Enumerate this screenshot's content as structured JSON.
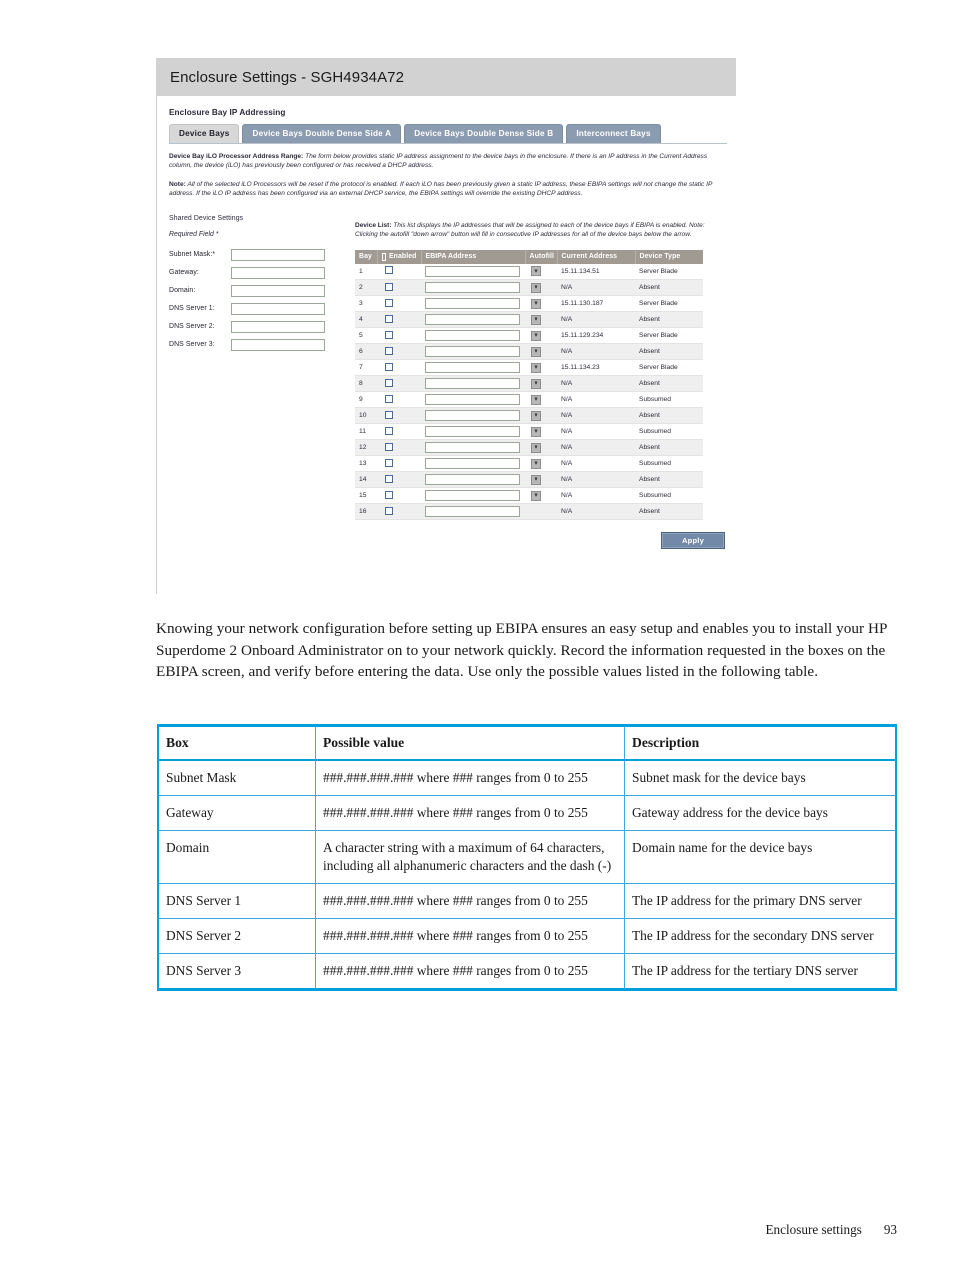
{
  "screenshot": {
    "title": "Enclosure Settings - SGH4934A72",
    "section_label": "Enclosure Bay IP Addressing",
    "tabs": [
      {
        "label": "Device Bays",
        "active": true
      },
      {
        "label": "Device Bays Double Dense Side A",
        "active": false
      },
      {
        "label": "Device Bays Double Dense Side B",
        "active": false
      },
      {
        "label": "Interconnect Bays",
        "active": false
      }
    ],
    "notes": [
      {
        "lead": "Device Bay iLO Processor Address Range:",
        "text": " The form below provides static IP address assignment to the device bays in the enclosure. If there is an IP address in the Current Address column, the device (iLO) has previously been configured or has received a DHCP address."
      },
      {
        "lead": "Note:",
        "text": " All of the selected iLO Processors will be reset if the protocol is enabled. If each iLO has been previously given a static IP address, these EBIPA settings will not change the static IP address. If the iLO IP address has been configured via an external DHCP service, the EBIPA settings will override the existing DHCP address."
      }
    ],
    "shared_settings": {
      "heading": "Shared Device Settings",
      "required_note": "Required Field *",
      "fields": [
        {
          "label": "Subnet Mask:*",
          "value": ""
        },
        {
          "label": "Gateway:",
          "value": ""
        },
        {
          "label": "Domain:",
          "value": ""
        },
        {
          "label": "DNS Server 1:",
          "value": ""
        },
        {
          "label": "DNS Server 2:",
          "value": ""
        },
        {
          "label": "DNS Server 3:",
          "value": ""
        }
      ]
    },
    "device_list": {
      "note_lead": "Device List:",
      "note_text": " This list displays the IP addresses that will be assigned to each of the device bays if EBIPA is enabled.  Note:  Clicking the autofill \"down arrow\" button will fill in consecutive IP addresses for all of the device bays below the arrow.",
      "columns": [
        "Bay",
        "Enabled",
        "EBIPA Address",
        "Autofill",
        "Current Address",
        "Device Type"
      ],
      "rows": [
        {
          "bay": "1",
          "enabled": false,
          "ebipa": "",
          "autofill": true,
          "current": "15.11.134.51",
          "type": "Server Blade"
        },
        {
          "bay": "2",
          "enabled": false,
          "ebipa": "",
          "autofill": true,
          "current": "N/A",
          "type": "Absent"
        },
        {
          "bay": "3",
          "enabled": false,
          "ebipa": "",
          "autofill": true,
          "current": "15.11.130.187",
          "type": "Server Blade"
        },
        {
          "bay": "4",
          "enabled": false,
          "ebipa": "",
          "autofill": true,
          "current": "N/A",
          "type": "Absent"
        },
        {
          "bay": "5",
          "enabled": false,
          "ebipa": "",
          "autofill": true,
          "current": "15.11.129.234",
          "type": "Server Blade"
        },
        {
          "bay": "6",
          "enabled": false,
          "ebipa": "",
          "autofill": true,
          "current": "N/A",
          "type": "Absent"
        },
        {
          "bay": "7",
          "enabled": false,
          "ebipa": "",
          "autofill": true,
          "current": "15.11.134.23",
          "type": "Server Blade"
        },
        {
          "bay": "8",
          "enabled": false,
          "ebipa": "",
          "autofill": true,
          "current": "N/A",
          "type": "Absent"
        },
        {
          "bay": "9",
          "enabled": false,
          "ebipa": "",
          "autofill": true,
          "current": "N/A",
          "type": "Subsumed"
        },
        {
          "bay": "10",
          "enabled": false,
          "ebipa": "",
          "autofill": true,
          "current": "N/A",
          "type": "Absent"
        },
        {
          "bay": "11",
          "enabled": false,
          "ebipa": "",
          "autofill": true,
          "current": "N/A",
          "type": "Subsumed"
        },
        {
          "bay": "12",
          "enabled": false,
          "ebipa": "",
          "autofill": true,
          "current": "N/A",
          "type": "Absent"
        },
        {
          "bay": "13",
          "enabled": false,
          "ebipa": "",
          "autofill": true,
          "current": "N/A",
          "type": "Subsumed"
        },
        {
          "bay": "14",
          "enabled": false,
          "ebipa": "",
          "autofill": true,
          "current": "N/A",
          "type": "Absent"
        },
        {
          "bay": "15",
          "enabled": false,
          "ebipa": "",
          "autofill": true,
          "current": "N/A",
          "type": "Subsumed"
        },
        {
          "bay": "16",
          "enabled": false,
          "ebipa": "",
          "autofill": false,
          "current": "N/A",
          "type": "Absent"
        }
      ]
    },
    "apply_label": "Apply",
    "autofill_glyph": "▾"
  },
  "body_paragraph": "Knowing your network configuration before setting up EBIPA ensures an easy setup and enables you to install your HP Superdome 2 Onboard Administrator on to your network quickly. Record the information requested in the boxes on the EBIPA screen, and verify before entering the data. Use only the possible values listed in the following table.",
  "data_table": {
    "headers": [
      "Box",
      "Possible value",
      "Description"
    ],
    "rows": [
      {
        "box": "Subnet Mask",
        "value": "###.###.###.### where ### ranges from 0 to 255",
        "description": "Subnet mask for the device bays"
      },
      {
        "box": "Gateway",
        "value": "###.###.###.### where ### ranges from 0 to 255",
        "description": "Gateway address for the device bays"
      },
      {
        "box": "Domain",
        "value": "A character string with a maximum of 64 characters, including all alphanumeric characters and the dash (-)",
        "description": "Domain name for the device bays"
      },
      {
        "box": "DNS Server 1",
        "value": "###.###.###.### where ### ranges from 0 to 255",
        "description": "The IP address for the primary DNS server"
      },
      {
        "box": "DNS Server 2",
        "value": "###.###.###.### where ### ranges from 0 to 255",
        "description": "The IP address for the secondary DNS server"
      },
      {
        "box": "DNS Server 3",
        "value": "###.###.###.### where ### ranges from 0 to 255",
        "description": "The IP address for the tertiary DNS server"
      }
    ]
  },
  "footer": {
    "section": "Enclosure settings",
    "page": "93"
  },
  "colors": {
    "title_bar": "#d2d2d2",
    "tab_inactive": "#8b9bb0",
    "tab_active": "#d8d8d8",
    "table_header": "#a09a92",
    "apply_button": "#7289a8",
    "data_table_accent": "#00a0df",
    "input_border": "#9aa79a"
  }
}
